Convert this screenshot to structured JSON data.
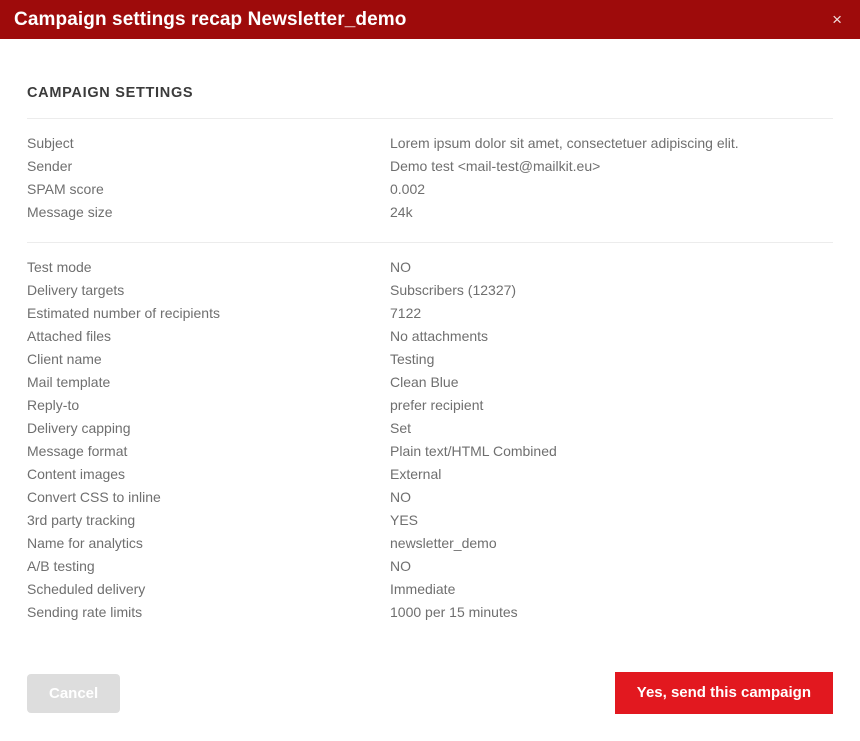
{
  "dialog": {
    "title": "Campaign settings recap Newsletter_demo",
    "close_label": "×",
    "close_icon": "close-icon",
    "header_color": "#9e0b0b"
  },
  "section": {
    "heading": "CAMPAIGN SETTINGS"
  },
  "groups": [
    {
      "rows": [
        {
          "label": "Subject",
          "value": "Lorem ipsum dolor sit amet, consectetuer adipiscing elit."
        },
        {
          "label": "Sender",
          "value": "Demo test <mail-test@mailkit.eu>"
        },
        {
          "label": "SPAM score",
          "value": "0.002"
        },
        {
          "label": "Message size",
          "value": "24k"
        }
      ]
    },
    {
      "rows": [
        {
          "label": "Test mode",
          "value": "NO"
        },
        {
          "label": "Delivery targets",
          "value": "Subscribers (12327)"
        },
        {
          "label": "Estimated number of recipients",
          "value": "7122"
        },
        {
          "label": "Attached files",
          "value": "No attachments"
        },
        {
          "label": "Client name",
          "value": "Testing"
        },
        {
          "label": "Mail template",
          "value": "Clean Blue"
        },
        {
          "label": "Reply-to",
          "value": "prefer recipient"
        },
        {
          "label": "Delivery capping",
          "value": "Set"
        },
        {
          "label": "Message format",
          "value": "Plain text/HTML Combined"
        },
        {
          "label": "Content images",
          "value": "External"
        },
        {
          "label": "Convert CSS to inline",
          "value": "NO"
        },
        {
          "label": "3rd party tracking",
          "value": "YES"
        },
        {
          "label": "Name for analytics",
          "value": "newsletter_demo"
        },
        {
          "label": "A/B testing",
          "value": "NO"
        },
        {
          "label": "Scheduled delivery",
          "value": "Immediate"
        },
        {
          "label": "Sending rate limits",
          "value": "1000 per 15 minutes"
        }
      ]
    }
  ],
  "footer": {
    "cancel_label": "Cancel",
    "send_label": "Yes, send this campaign",
    "send_color": "#e2181f",
    "cancel_color": "#dddddd"
  }
}
